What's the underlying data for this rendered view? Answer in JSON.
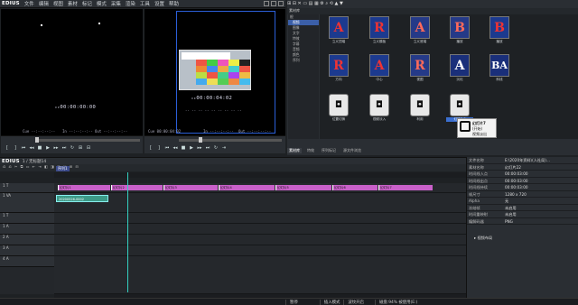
{
  "app": {
    "logo": "EDIUS"
  },
  "menu": [
    "文件",
    "编辑",
    "视图",
    "素材",
    "标记",
    "模式",
    "采集",
    "渲染",
    "工具",
    "设置",
    "帮助"
  ],
  "player": {
    "timecode": "00:00:00:00",
    "cue_label": "Cue",
    "in_label": "In",
    "out_label": "Out",
    "dur_label": "Dur"
  },
  "recorder": {
    "timecode": "00:00:04:02",
    "cue_label": "Cue",
    "in_label": "In",
    "out_label": "Out",
    "dur_label": "Dur",
    "cue_value": "00:00:04:02"
  },
  "bin": {
    "title": "素材库",
    "tree": [
      "根",
      "视频",
      "图像",
      "文字",
      "特效",
      "字幕",
      "音频",
      "颜色",
      "序列"
    ],
    "items": [
      {
        "label": "立义顶端",
        "glyph": "A",
        "style": "red"
      },
      {
        "label": "立义模板",
        "glyph": "R",
        "style": "red"
      },
      {
        "label": "立义底端",
        "glyph": "A",
        "style": "soft"
      },
      {
        "label": "播放",
        "glyph": "B",
        "style": "soft"
      },
      {
        "label": "播放",
        "glyph": "B",
        "style": "red"
      },
      {
        "label": "方向",
        "glyph": "R",
        "style": "red"
      },
      {
        "label": "中心",
        "glyph": "A",
        "style": "red"
      },
      {
        "label": "视图",
        "glyph": "R",
        "style": "soft"
      },
      {
        "label": "淡化",
        "glyph": "A",
        "style": "white"
      },
      {
        "label": "斜线",
        "glyph": "BA",
        "style": "white"
      },
      {
        "label": "位置切换",
        "glyph": "◘",
        "style": "icon"
      },
      {
        "label": "视频淡入",
        "glyph": "◘",
        "style": "icon"
      },
      {
        "label": "利用",
        "glyph": "◘",
        "style": "icon"
      },
      {
        "label": "幻灯片7",
        "glyph": "◘",
        "style": "icon"
      }
    ],
    "tooltip": {
      "line1": "幻灯片7",
      "line2": "(开始)",
      "line3": "视频淡出"
    },
    "tabs": [
      "素材库",
      "特效",
      "序列标记",
      "源文件浏览"
    ]
  },
  "timeline": {
    "logo": "EDIUS",
    "project": "1 / 无标题14",
    "sequence_tab": "序列1",
    "tracks": [
      {
        "name": "1 T",
        "type": "title"
      },
      {
        "name": "1 VA",
        "type": "va"
      },
      {
        "name": "1 T",
        "type": "t"
      },
      {
        "name": "1 A",
        "type": "a"
      },
      {
        "name": "2 A",
        "type": "a"
      },
      {
        "name": "3 A",
        "type": "a"
      },
      {
        "name": "4 A",
        "type": "a"
      }
    ],
    "clips": [
      "幻灯片1",
      "幻灯片2",
      "幻灯片3",
      "幻灯片4",
      "幻灯片5",
      "幻灯片6",
      "幻灯片7"
    ],
    "va_clip": "20200526-0002",
    "ruler_labels": [
      "00:00:00",
      "00:00:05:00",
      "00:00:10:00",
      "00:00:15:00",
      "00:00:20:00",
      "00:00:25:00"
    ]
  },
  "info": {
    "rows": [
      {
        "k": "文件名称",
        "v": "E:\\2020年资料\\(人社局)..."
      },
      {
        "k": "素材名称",
        "v": "幻灯片22"
      },
      {
        "k": "时间线入点",
        "v": "00:00:03:00"
      },
      {
        "k": "时间线出点",
        "v": "00:00:03:00"
      },
      {
        "k": "时间线持续",
        "v": "00:00:03:00"
      },
      {
        "k": "帧尺寸",
        "v": "1280 x 720"
      },
      {
        "k": "Alpha",
        "v": "无"
      },
      {
        "k": "冻结帧",
        "v": "未启用"
      },
      {
        "k": "时间重映射",
        "v": "未启用"
      },
      {
        "k": "编解码器",
        "v": "PNG"
      }
    ],
    "footer": "视频布局"
  },
  "status": {
    "pause": "暂停",
    "insert": "插入模式",
    "ripple": "波纹开启",
    "disk": "磁盘:94% 被使用(E:)"
  }
}
